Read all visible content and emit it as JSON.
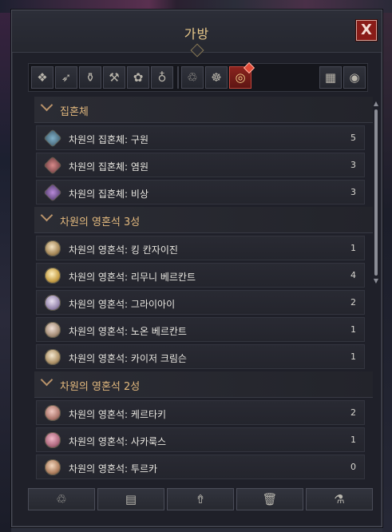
{
  "window": {
    "title": "가방",
    "close_label": "X"
  },
  "tabs": [
    {
      "icon": "all-items-icon",
      "glyph": "❖"
    },
    {
      "icon": "bow-weapon-icon",
      "glyph": "➶"
    },
    {
      "icon": "potion-icon",
      "glyph": "⚱"
    },
    {
      "icon": "anvil-icon",
      "glyph": "⚒"
    },
    {
      "icon": "herb-icon",
      "glyph": "✿"
    },
    {
      "icon": "pouch-icon",
      "glyph": "♁"
    },
    {
      "icon": "currency-icon",
      "glyph": "♲"
    },
    {
      "icon": "moon-emblem-icon",
      "glyph": "☸"
    },
    {
      "icon": "coins-icon",
      "glyph": "◎"
    }
  ],
  "view_buttons": [
    {
      "icon": "grid-view-icon",
      "glyph": "▦"
    },
    {
      "icon": "eye-icon",
      "glyph": "◉"
    }
  ],
  "groups": [
    {
      "label": "집혼체",
      "items": [
        {
          "name": "차원의 집혼체: 구원",
          "count": "5"
        },
        {
          "name": "차원의 집혼체: 염원",
          "count": "3"
        },
        {
          "name": "차원의 집혼체: 비상",
          "count": "3"
        }
      ]
    },
    {
      "label": "차원의 영혼석 3성",
      "items": [
        {
          "name": "차원의 영혼석: 킹 칸자이진",
          "count": "1"
        },
        {
          "name": "차원의 영혼석: 리무니 베르칸트",
          "count": "4"
        },
        {
          "name": "차원의 영혼석: 그라이아이",
          "count": "2"
        },
        {
          "name": "차원의 영혼석: 노온 베르칸트",
          "count": "1"
        },
        {
          "name": "차원의 영혼석: 카이저 크림슨",
          "count": "1"
        }
      ]
    },
    {
      "label": "차원의 영혼석 2성",
      "items": [
        {
          "name": "차원의 영혼석: 케르타키",
          "count": "2"
        },
        {
          "name": "차원의 영혼석: 사카룩스",
          "count": "1"
        },
        {
          "name": "차원의 영혼석: 투르카",
          "count": "0"
        }
      ]
    }
  ],
  "bottom_buttons": [
    {
      "icon": "currency-convert-icon",
      "glyph": "♲"
    },
    {
      "icon": "scroll-map-icon",
      "glyph": "▤"
    },
    {
      "icon": "upgrade-statue-icon",
      "glyph": "⇮"
    },
    {
      "icon": "trash-icon",
      "glyph": "🗑"
    },
    {
      "icon": "flask-icon",
      "glyph": "⚗"
    }
  ]
}
